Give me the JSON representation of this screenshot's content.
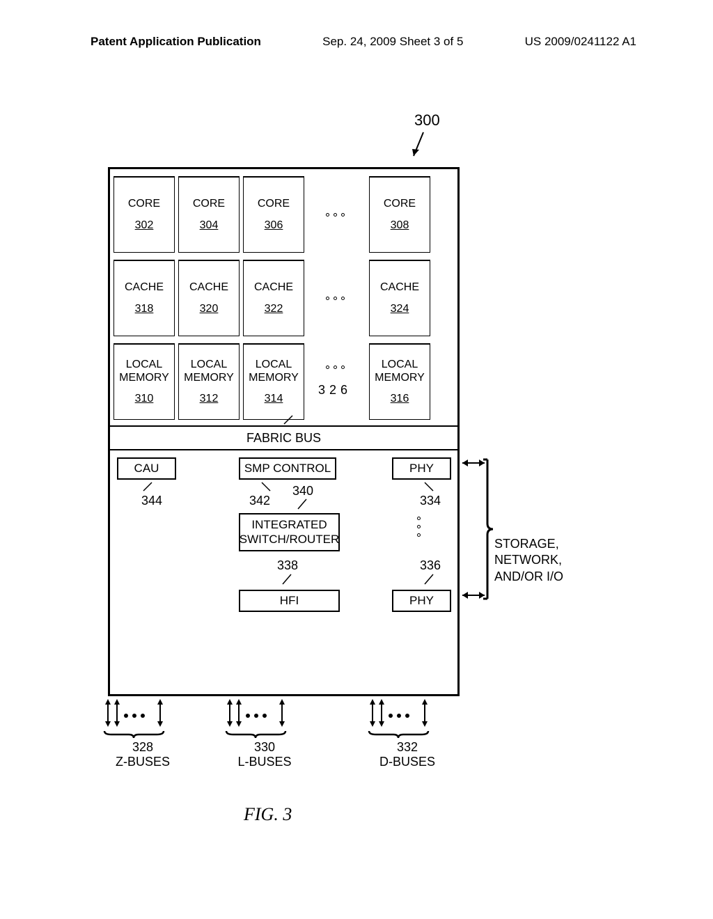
{
  "header": {
    "left": "Patent Application Publication",
    "center": "Sep. 24, 2009  Sheet 3 of 5",
    "right": "US 2009/0241122 A1"
  },
  "label300": "300",
  "rows": {
    "core": {
      "title": "CORE",
      "refs": [
        "302",
        "304",
        "306",
        "308"
      ]
    },
    "cache": {
      "title": "CACHE",
      "refs": [
        "318",
        "320",
        "322",
        "324"
      ]
    },
    "memory": {
      "title_l1": "LOCAL",
      "title_l2": "MEMORY",
      "refs": [
        "310",
        "312",
        "314",
        "316"
      ],
      "dots_ref": "326"
    }
  },
  "fabric": "FABRIC BUS",
  "bottom": {
    "cau": "CAU",
    "cau_ref": "344",
    "smp": "SMP CONTROL",
    "smp_ref": "342",
    "isr_l1": "INTEGRATED",
    "isr_l2": "SWITCH/ROUTER",
    "isr_ref": "340",
    "hfi": "HFI",
    "hfi_ref": "338",
    "phy_top": "PHY",
    "phy_top_ref": "334",
    "phy_bot": "PHY",
    "phy_bot_ref": "336"
  },
  "storage": {
    "l1": "STORAGE,",
    "l2": "NETWORK,",
    "l3": "AND/OR I/O"
  },
  "buses": {
    "z": {
      "ref": "328",
      "name": "Z-BUSES"
    },
    "l": {
      "ref": "330",
      "name": "L-BUSES"
    },
    "d": {
      "ref": "332",
      "name": "D-BUSES"
    }
  },
  "figcap": "FIG. 3"
}
